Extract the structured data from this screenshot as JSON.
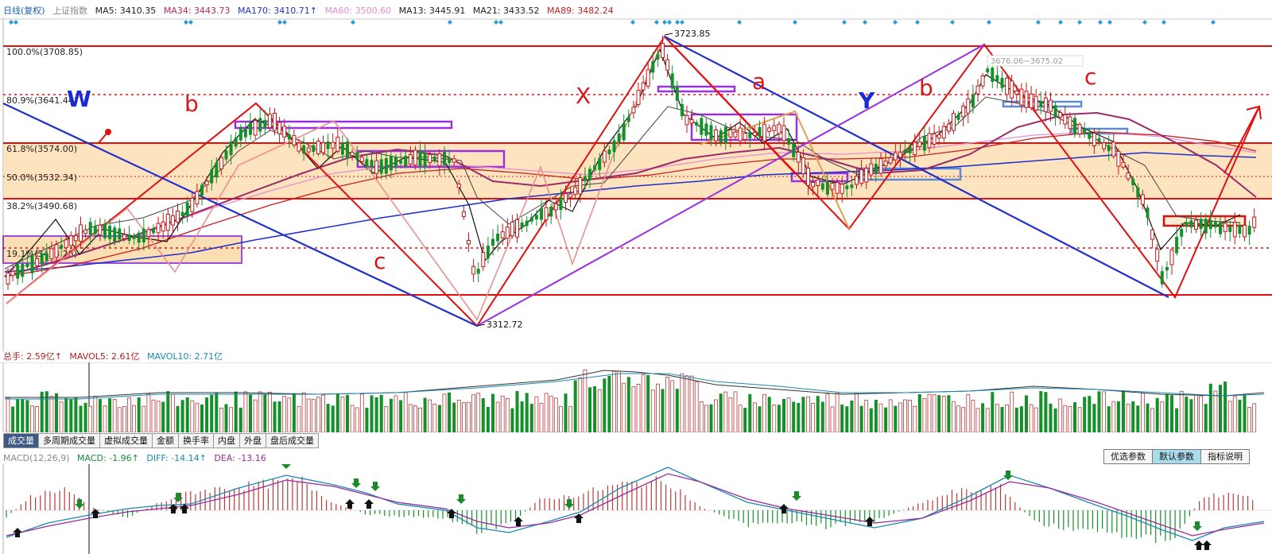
{
  "header": {
    "title": "日线(复权)",
    "index_name": "上证指数",
    "ma": [
      {
        "label": "MA5: 3410.35",
        "color": "#222222"
      },
      {
        "label": "MA34: 3443.73",
        "color": "#b8285c"
      },
      {
        "label": "MA170: 3410.71↑",
        "color": "#2233cc"
      },
      {
        "label": "MA60: 3500.60",
        "color": "#e98bd1"
      },
      {
        "label": "MA13: 3445.91",
        "color": "#222222"
      },
      {
        "label": "MA21: 3433.52",
        "color": "#222222"
      },
      {
        "label": "MA89: 3482.24",
        "color": "#c81e1e"
      }
    ]
  },
  "price_chart": {
    "fib_labels": [
      "100.0%(3708.85)",
      "80.9%(3641.44)",
      "61.8%(3574.00)",
      "50.0%(3532.34)",
      "38.2%(3490.68)",
      "19.1%(3423.28)"
    ],
    "high_label": "3723.85",
    "low_label": "3312.72",
    "range_note": "3676.06~3675.02",
    "wave_labels": [
      {
        "text": "W",
        "color": "#1a2ad4"
      },
      {
        "text": "b",
        "color": "#d81818"
      },
      {
        "text": "c",
        "color": "#d81818"
      },
      {
        "text": "X",
        "color": "#d81818"
      },
      {
        "text": "a",
        "color": "#d81818"
      },
      {
        "text": "Y",
        "color": "#1a2ad4"
      },
      {
        "text": "b",
        "color": "#d81818"
      },
      {
        "text": "c",
        "color": "#d81818"
      }
    ]
  },
  "volume": {
    "labels": [
      {
        "label": "总手: 2.59亿↑",
        "color": "#b22222"
      },
      {
        "label": "MAVOL5: 2.61亿",
        "color": "#b22222"
      },
      {
        "label": "MAVOL10: 2.71亿",
        "color": "#1a8ab0"
      }
    ]
  },
  "tabs": [
    "成交量",
    "多周期成交量",
    "虚拟成交量",
    "金额",
    "换手率",
    "内盘",
    "外盘",
    "盘后成交量"
  ],
  "macd": {
    "labels": [
      {
        "label": "MACD(12,26,9)",
        "color": "#8a8a8a"
      },
      {
        "label": "MACD: -1.96↑",
        "color": "#1a8a3a"
      },
      {
        "label": "DIFF: -14.14↑",
        "color": "#1a8ab0"
      },
      {
        "label": "DEA: -13.16",
        "color": "#9a2a9a"
      }
    ]
  },
  "param_buttons": [
    "优选参数",
    "默认参数",
    "指标说明"
  ],
  "colors": {
    "up": "#c01818",
    "down": "#14902a",
    "fib_band": "#fcd9a8",
    "fib_line": "#e01010",
    "trend_blue": "#2030cc",
    "trend_purple": "#9a30e0",
    "wave_red": "#e01010"
  }
}
